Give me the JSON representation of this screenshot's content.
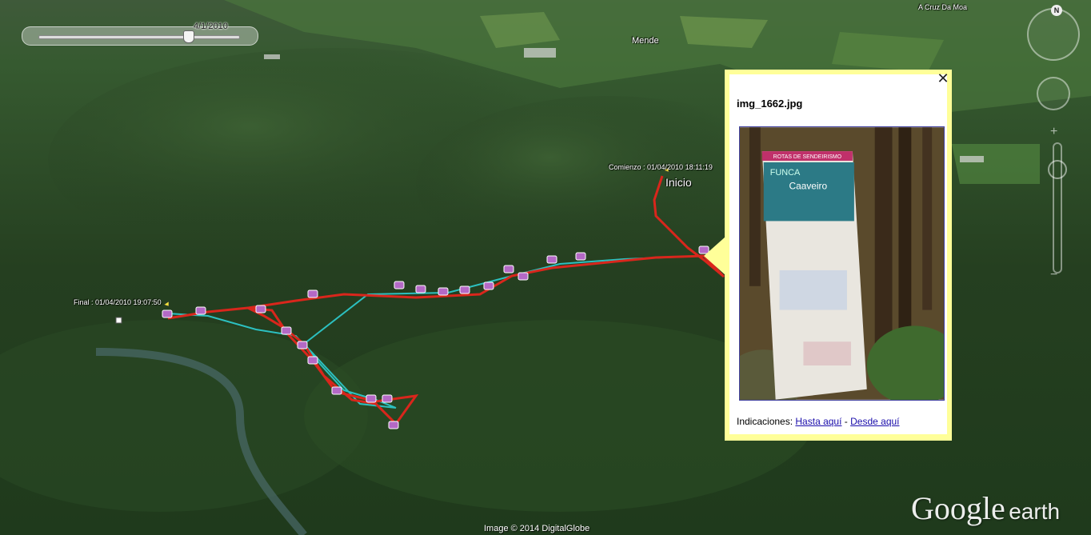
{
  "time_slider": {
    "date": "4/1/2010"
  },
  "places": {
    "mende": "Mende",
    "cruz": "A Cruz Da Moa"
  },
  "track": {
    "start_label": "Comienzo : 01/04/2010 18:11:19",
    "start_name": "Inicio",
    "end_label": "Final : 01/04/2010 19:07:50"
  },
  "nav": {
    "north": "N"
  },
  "popup": {
    "title": "img_1662.jpg",
    "close": "✕",
    "directions_label": "Indicaciones:",
    "link_to": "Hasta aquí",
    "separator": "-",
    "link_from": "Desde aquí",
    "sign": {
      "header": "ROTAS DE SENDEIRISMO",
      "line1": "FUNCA",
      "place": "Caaveiro"
    }
  },
  "credit": "Image © 2014 DigitalGlobe",
  "logo": {
    "google": "Google",
    "earth": "earth"
  },
  "colors": {
    "track_red": "#d9261c",
    "track_cyan": "#2cc0c0",
    "popup_border": "#ffff99",
    "link": "#1a0dab"
  }
}
